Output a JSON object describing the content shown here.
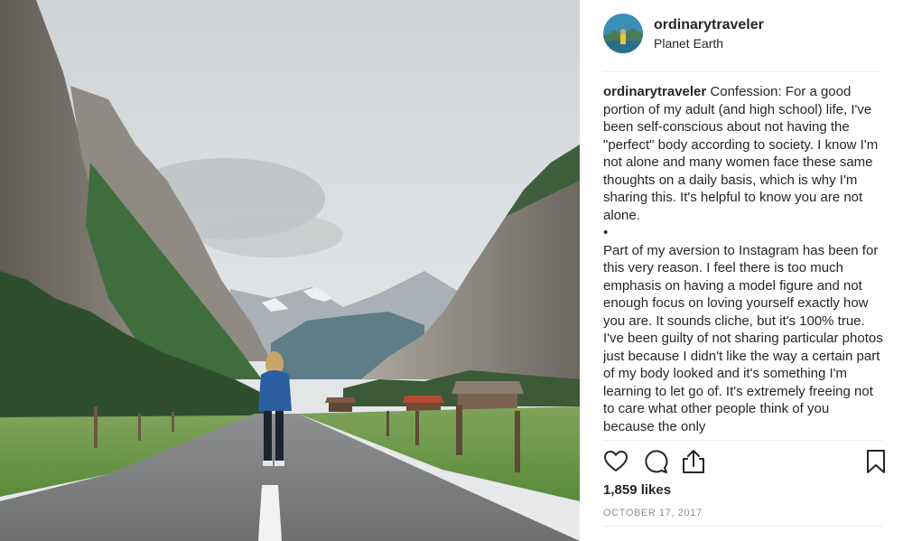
{
  "author": {
    "username": "ordinarytraveler",
    "location": "Planet Earth"
  },
  "caption": {
    "username": "ordinarytraveler",
    "paragraph_1": "Confession: For a good portion of my adult (and high school) life, I've been self-conscious about not having the \"perfect\" body according to society. I know I'm not alone and many women face these same thoughts on a daily basis, which is why I'm sharing this. It's helpful to know you are not alone.",
    "separator": "•",
    "paragraph_2": "Part of my aversion to Instagram has been for this very reason. I feel there is too much emphasis on having a model figure and not enough focus on loving yourself exactly how you are. It sounds cliche, but it's 100% true. I've been guilty of not sharing particular photos just because I didn't like the way a certain part of my body looked and it's something I'm learning to let go of. It's extremely freeing not to care what other people think of you because the only"
  },
  "actions": {
    "like_icon": "heart-icon",
    "comment_icon": "comment-icon",
    "share_icon": "share-icon",
    "save_icon": "bookmark-icon"
  },
  "stats": {
    "likes": "1,859 likes",
    "date": "OCTOBER 17, 2017"
  }
}
